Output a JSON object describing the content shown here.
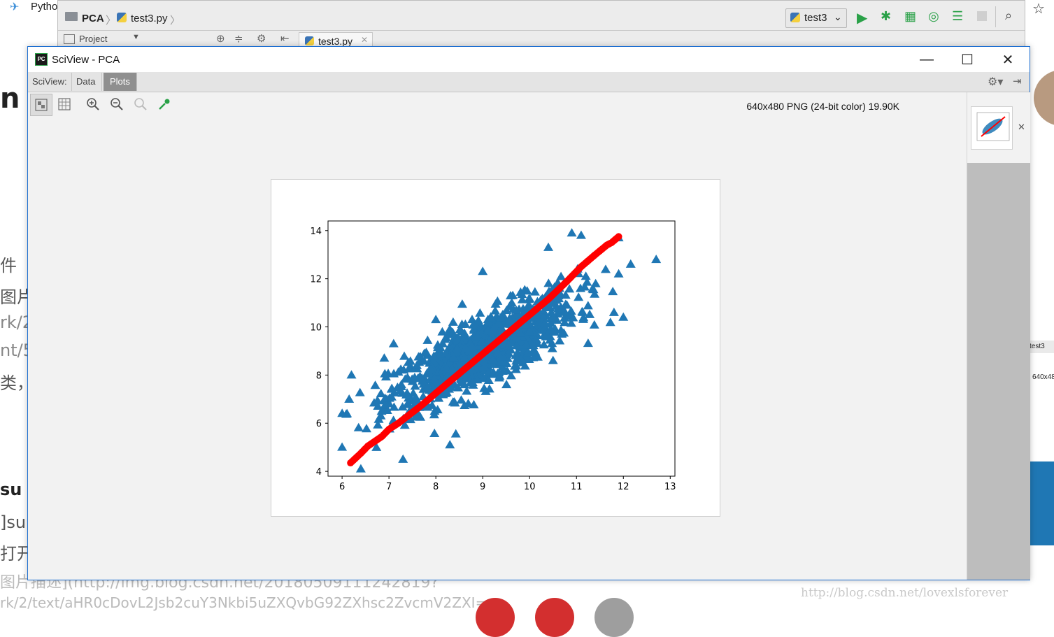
{
  "background": {
    "left_fragments": [
      "n",
      "件",
      "图片",
      "rk/2",
      "nt/5",
      "类，但",
      "su",
      "]sub",
      "打开",
      "图片描述](http://img.blog.csdn.net/20180509111242819?",
      "rk/2/text/aHR0cDovL2Jsb2cuY3Nkbi5uZXQvbG92ZXhsc2ZvcmV2ZXI="
    ],
    "right_fragments": [
      "test3",
      "640x48"
    ],
    "watermark": "http://blog.csdn.net/lovexlsforever"
  },
  "ide": {
    "app_title": "Pytho",
    "project": "PCA",
    "file": "test3.py",
    "run_config": "test3",
    "project_panel": "Project",
    "tab": "test3.py"
  },
  "window": {
    "title": "SciView - PCA",
    "minimize": "—",
    "maximize": "☐",
    "close": "✕"
  },
  "sciview": {
    "label": "SciView:",
    "tabs": [
      "Data",
      "Plots"
    ],
    "active_tab": "Plots",
    "image_info": "640x480 PNG (24-bit color) 19.90K"
  },
  "colors": {
    "scatter": "#1f77b4",
    "line": "#ff0000",
    "accent": "#1e6fd1"
  },
  "chart_data": {
    "type": "scatter",
    "title": "",
    "xlabel": "",
    "ylabel": "",
    "xlim": [
      5.7,
      13.1
    ],
    "ylim": [
      3.8,
      14.4
    ],
    "xticks": [
      6,
      7,
      8,
      9,
      10,
      11,
      12,
      13
    ],
    "yticks": [
      4,
      6,
      8,
      10,
      12,
      14
    ],
    "series": [
      {
        "marker": "triangle",
        "color": "#1f77b4",
        "distribution": {
          "n": 1000,
          "center": [
            9.0,
            9.0
          ],
          "std": [
            1.0,
            1.2
          ],
          "corr": 0.8
        },
        "points": [
          [
            6.0,
            5.0
          ],
          [
            6.2,
            8.0
          ],
          [
            6.4,
            4.1
          ],
          [
            7.3,
            4.5
          ],
          [
            8.3,
            5.1
          ],
          [
            7.1,
            9.3
          ],
          [
            6.9,
            8.7
          ],
          [
            10.9,
            13.9
          ],
          [
            11.1,
            13.8
          ],
          [
            10.4,
            13.3
          ],
          [
            11.9,
            13.7
          ],
          [
            12.7,
            12.8
          ],
          [
            11.9,
            12.2
          ],
          [
            11.2,
            12.1
          ],
          [
            11.8,
            10.6
          ],
          [
            12.0,
            10.4
          ],
          [
            9.0,
            12.3
          ],
          [
            8.0,
            10.3
          ],
          [
            10.5,
            8.6
          ]
        ]
      },
      {
        "marker": "circle",
        "color": "#ff0000",
        "points": [
          [
            6.18,
            4.35
          ],
          [
            6.4,
            4.75
          ],
          [
            6.55,
            5.05
          ],
          [
            6.7,
            5.25
          ],
          [
            6.85,
            5.45
          ],
          [
            7.0,
            5.75
          ],
          [
            7.2,
            6.0
          ],
          [
            7.4,
            6.3
          ],
          [
            7.7,
            6.75
          ],
          [
            8.0,
            7.25
          ],
          [
            8.4,
            7.9
          ],
          [
            8.8,
            8.55
          ],
          [
            9.2,
            9.2
          ],
          [
            9.6,
            9.85
          ],
          [
            10.0,
            10.5
          ],
          [
            10.4,
            11.15
          ],
          [
            10.8,
            11.9
          ],
          [
            11.1,
            12.5
          ],
          [
            11.4,
            13.0
          ],
          [
            11.65,
            13.4
          ],
          [
            11.75,
            13.5
          ],
          [
            11.9,
            13.75
          ]
        ]
      }
    ]
  }
}
